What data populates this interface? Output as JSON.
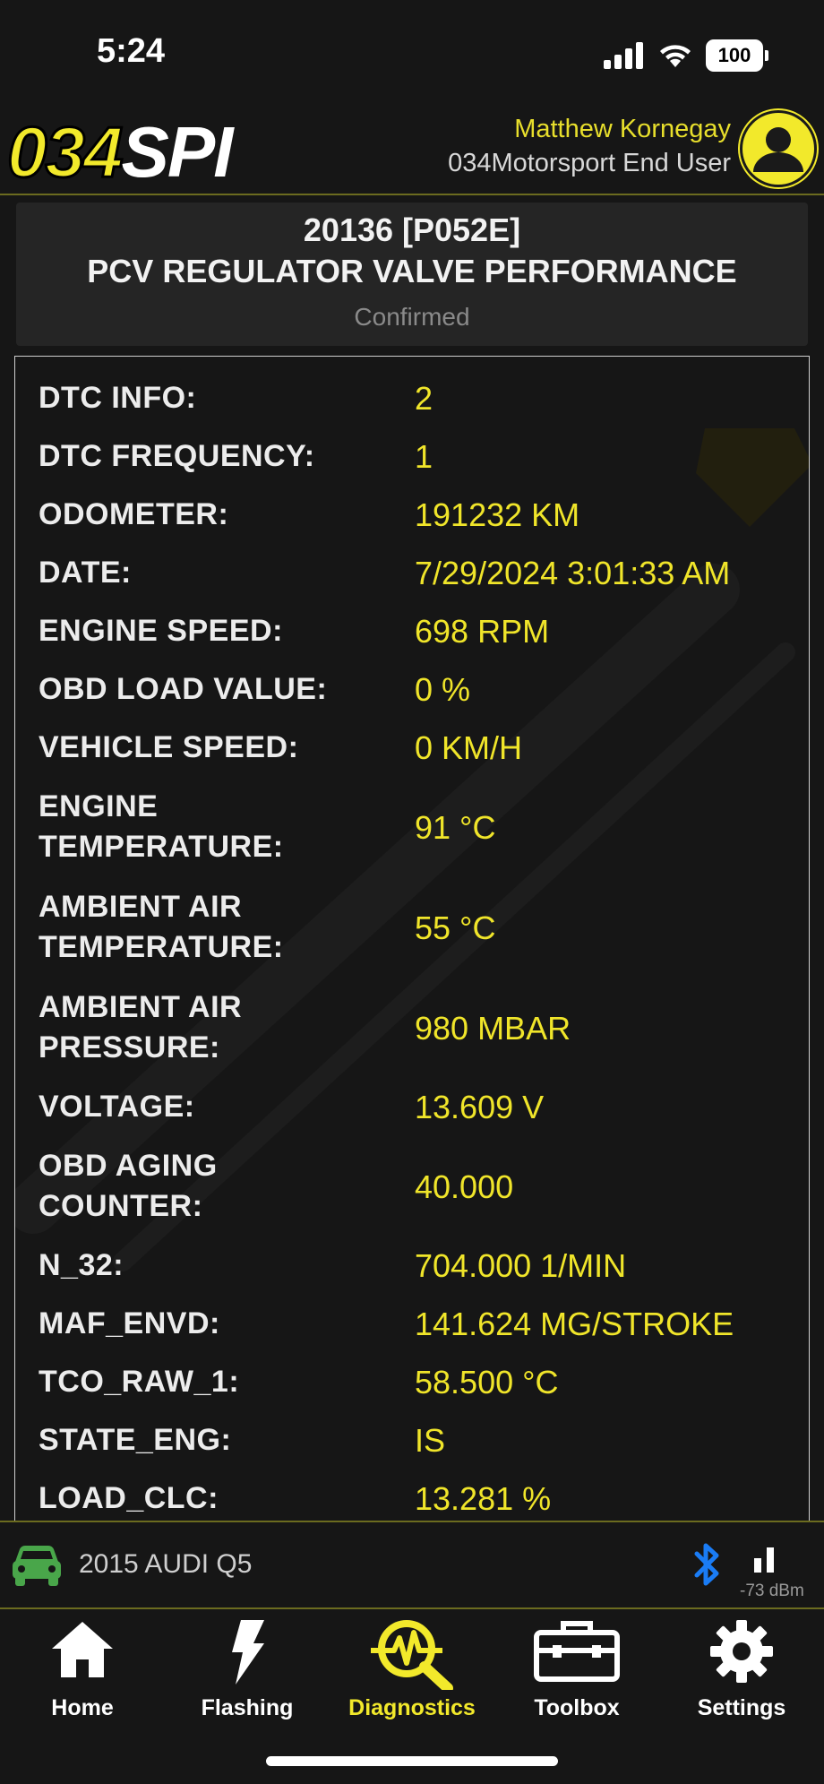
{
  "status_bar": {
    "time": "5:24",
    "battery": "100"
  },
  "header": {
    "logo_part1": "034",
    "logo_part2": "SPI",
    "user_name": "Matthew Kornegay",
    "user_role": "034Motorsport End User"
  },
  "dtc": {
    "code": "20136 [P052E]",
    "description": "PCV REGULATOR VALVE PERFORMANCE",
    "status": "Confirmed"
  },
  "rows": [
    {
      "label": "DTC INFO:",
      "value": "2"
    },
    {
      "label": "DTC FREQUENCY:",
      "value": "1"
    },
    {
      "label": "ODOMETER:",
      "value": "191232 KM"
    },
    {
      "label": "DATE:",
      "value": "7/29/2024 3:01:33 AM"
    },
    {
      "label": "ENGINE SPEED:",
      "value": "698 RPM"
    },
    {
      "label": "OBD LOAD VALUE:",
      "value": "0 %"
    },
    {
      "label": "VEHICLE SPEED:",
      "value": "0 KM/H"
    },
    {
      "label_line1": "ENGINE",
      "label_line2": "TEMPERATURE:",
      "value": "91 °C"
    },
    {
      "label_line1": "AMBIENT AIR",
      "label_line2": "TEMPERATURE:",
      "value": "55 °C"
    },
    {
      "label_line1": "AMBIENT AIR",
      "label_line2": "PRESSURE:",
      "value": "980 MBAR"
    },
    {
      "label": "VOLTAGE:",
      "value": "13.609 V"
    },
    {
      "label_line1": "OBD AGING",
      "label_line2": "COUNTER:",
      "value": "40.000"
    },
    {
      "label": "N_32:",
      "value": "704.000 1/MIN"
    },
    {
      "label": "MAF_ENVD:",
      "value": "141.624 MG/STROKE"
    },
    {
      "label": "TCO_RAW_1:",
      "value": "58.500 °C"
    },
    {
      "label": "STATE_ENG:",
      "value": "IS"
    },
    {
      "label": "LOAD_CLC:",
      "value": "13.281 %"
    }
  ],
  "vehicle": {
    "name": "2015 AUDI Q5",
    "signal": "-73 dBm"
  },
  "nav": {
    "home": "Home",
    "flashing": "Flashing",
    "diagnostics": "Diagnostics",
    "toolbox": "Toolbox",
    "settings": "Settings"
  },
  "icons": {
    "cellular": "cellular-signal-icon",
    "wifi": "wifi-icon",
    "battery": "battery-icon",
    "avatar": "user-avatar-icon",
    "car": "car-icon",
    "bluetooth": "bluetooth-icon",
    "signal": "signal-strength-icon",
    "home": "home-icon",
    "flashing": "lightning-bolt-icon",
    "diagnostics": "diagnostics-magnifier-icon",
    "toolbox": "toolbox-icon",
    "settings": "gear-icon"
  },
  "colors": {
    "accent": "#f2e92b",
    "background": "#161616",
    "card": "#252525",
    "bluetooth": "#1a7cf5",
    "car": "#49a64a"
  }
}
